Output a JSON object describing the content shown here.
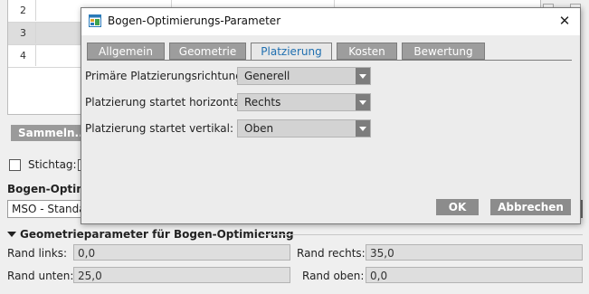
{
  "background": {
    "rows": [
      {
        "num": "2"
      },
      {
        "num": "3"
      },
      {
        "num": "4"
      }
    ],
    "sammeln_label": "Sammeln...",
    "stichtag_label": "Stichtag:",
    "bogen_section_label": "Bogen-Optimie",
    "bogen_combo_value": "MSO - Standa",
    "geometry_section_title": "Geometrieparameter für Bogen-Optimierung",
    "fields": {
      "rand_links_label": "Rand links:",
      "rand_links_value": "0,0",
      "rand_rechts_label": "Rand rechts:",
      "rand_rechts_value": "35,0",
      "rand_unten_label": "Rand unten:",
      "rand_unten_value": "25,0",
      "rand_oben_label": "Rand oben:",
      "rand_oben_value": "0,0"
    }
  },
  "dialog": {
    "title": "Bogen-Optimierungs-Parameter",
    "close_glyph": "✕",
    "tabs": [
      {
        "label": "Allgemein",
        "active": false
      },
      {
        "label": "Geometrie",
        "active": false
      },
      {
        "label": "Platzierung",
        "active": true
      },
      {
        "label": "Kosten",
        "active": false
      },
      {
        "label": "Bewertung",
        "active": false
      }
    ],
    "rows": [
      {
        "label": "Primäre Platzierungsrichtung:",
        "value": "Generell"
      },
      {
        "label": "Platzierung startet horizontal:",
        "value": "Rechts"
      },
      {
        "label": "Platzierung startet vertikal:",
        "value": "Oben"
      }
    ],
    "ok_label": "OK",
    "cancel_label": "Abbrechen"
  },
  "colors": {
    "active_tab_text": "#1f6fb0",
    "tab_bg": "#9d9d9d",
    "button_bg": "#8c8c8c",
    "dialog_bg": "#ececec"
  }
}
